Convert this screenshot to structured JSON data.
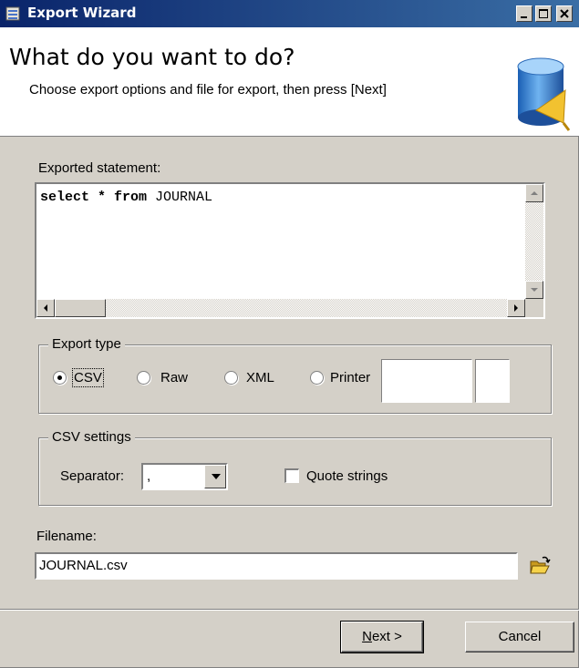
{
  "window": {
    "title": "Export Wizard"
  },
  "header": {
    "heading": "What do you want to do?",
    "subtitle": "Choose export options and file for export, then press [Next]",
    "icon": "database-icon"
  },
  "statement": {
    "label": "Exported statement:",
    "keyword_part": "select * from",
    "table_part": " JOURNAL"
  },
  "export_type": {
    "legend": "Export type",
    "options": [
      "CSV",
      "Raw",
      "XML",
      "Printer"
    ],
    "selected": "CSV"
  },
  "csv_settings": {
    "legend": "CSV settings",
    "separator_label": "Separator:",
    "separator_value": ",",
    "quote_strings_label": "Quote strings",
    "quote_strings_checked": false
  },
  "filename": {
    "label": "Filename:",
    "value": "JOURNAL.csv",
    "browse_icon": "folder-open-icon"
  },
  "buttons": {
    "next_accel": "N",
    "next_rest": "ext >",
    "cancel": "Cancel"
  }
}
